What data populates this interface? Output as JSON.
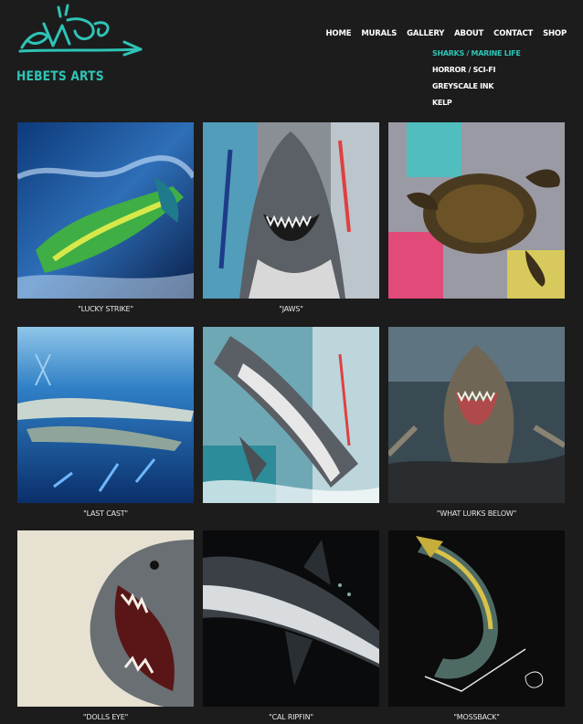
{
  "site": {
    "title": "HEBETS ARTS",
    "logo_name": "graffiti-signature-logo"
  },
  "nav": [
    {
      "label": "HOME"
    },
    {
      "label": "MURALS"
    },
    {
      "label": "GALLERY"
    },
    {
      "label": "ABOUT"
    },
    {
      "label": "CONTACT"
    },
    {
      "label": "SHOP"
    }
  ],
  "gallery_menu": [
    {
      "label": "SHARKS / MARINE LIFE",
      "active": true
    },
    {
      "label": "HORROR / SCI-FI",
      "active": false
    },
    {
      "label": "GREYSCALE INK",
      "active": false
    },
    {
      "label": "KELP",
      "active": false
    }
  ],
  "artworks": [
    {
      "caption": "\"LUCKY STRIKE\""
    },
    {
      "caption": "\"JAWS\""
    },
    {
      "caption": ""
    },
    {
      "caption": "\"LAST CAST\""
    },
    {
      "caption": ""
    },
    {
      "caption": "\"WHAT LURKS BELOW\""
    },
    {
      "caption": "\"DOLLS EYE\""
    },
    {
      "caption": "\"CAL RIPFIN\""
    },
    {
      "caption": "\"MOSSBACK\""
    }
  ],
  "colors": {
    "background": "#1c1c1d",
    "accent": "#2ec4b6",
    "text": "#ffffff"
  }
}
